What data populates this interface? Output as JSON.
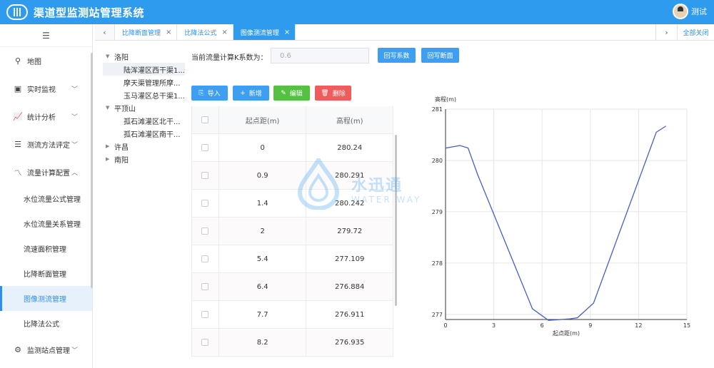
{
  "app": {
    "title": "渠道型监测站管理系统",
    "user_name": "测试"
  },
  "sidebar": {
    "items": [
      {
        "label": "地图",
        "icon": "location-icon",
        "glyph": "⚲",
        "has_chevron": false
      },
      {
        "label": "实时监视",
        "icon": "monitor-icon",
        "glyph": "▣",
        "has_chevron": true
      },
      {
        "label": "统计分析",
        "icon": "stats-icon",
        "glyph": "📈",
        "has_chevron": true
      },
      {
        "label": "测流方法评定",
        "icon": "list-icon",
        "glyph": "☰",
        "has_chevron": true
      },
      {
        "label": "流量计算配置",
        "icon": "flow-icon",
        "glyph": "〽",
        "has_chevron": true
      }
    ],
    "sub_items": [
      "水位流量公式管理",
      "水位流量关系管理",
      "流速面积管理",
      "比降断面管理",
      "图像测流管理",
      "比降法公式"
    ],
    "active_sub": "图像测流管理",
    "last_item": {
      "label": "监测站点管理",
      "icon": "station-icon",
      "glyph": "⚙"
    }
  },
  "tabs": [
    {
      "label": "比降断面管理",
      "active": false
    },
    {
      "label": "比降法公式",
      "active": false
    },
    {
      "label": "图像测流管理",
      "active": true
    }
  ],
  "tab_close_all": "全部关闭",
  "tree": [
    {
      "label": "洛阳",
      "expanded": true,
      "children": [
        "陆浑灌区西干渠1...",
        "摩天渠管理所摩...",
        "玉马灌区总干渠1..."
      ]
    },
    {
      "label": "平顶山",
      "expanded": true,
      "children": [
        "孤石滩灌区北干...",
        "孤石滩灌区南干..."
      ]
    },
    {
      "label": "许昌",
      "expanded": false,
      "children": []
    },
    {
      "label": "南阳",
      "expanded": false,
      "children": []
    }
  ],
  "k_label": "当前流量计算K系数为：",
  "k_value": "0.6",
  "buttons": {
    "write_coef": "回写系数",
    "write_section": "回写断面",
    "import": "导入",
    "add": "新增",
    "edit": "编辑",
    "delete": "删除"
  },
  "table": {
    "headers": [
      "起点距(m)",
      "高程(m)"
    ],
    "rows": [
      [
        "0",
        "280.24"
      ],
      [
        "0.9",
        "280.291"
      ],
      [
        "1.4",
        "280.242"
      ],
      [
        "2",
        "279.72"
      ],
      [
        "5.4",
        "277.109"
      ],
      [
        "6.4",
        "276.884"
      ],
      [
        "7.7",
        "276.911"
      ],
      [
        "8.2",
        "276.935"
      ]
    ]
  },
  "watermark": {
    "text": "水迅通",
    "sub": "WATER WAY"
  },
  "colors": {
    "header": "#2f9bef",
    "accent": "#2f8fe8",
    "green": "#54c142",
    "red": "#f05b5b",
    "line": "#4560c0"
  },
  "chart_data": {
    "type": "line",
    "title": "",
    "xlabel": "起点距(m)",
    "ylabel": "高程(m)",
    "xlim": [
      0,
      15
    ],
    "ylim": [
      276.9,
      281
    ],
    "xticks": [
      0,
      3,
      6,
      9,
      12,
      15
    ],
    "yticks": [
      277,
      278,
      279,
      280,
      281
    ],
    "grid": true,
    "series": [
      {
        "x": [
          0,
          0.9,
          1.4,
          2,
          5.4,
          6.4,
          7.7,
          8.2,
          9.2,
          13.1,
          13.7
        ],
        "y": [
          280.24,
          280.291,
          280.242,
          279.72,
          277.109,
          276.884,
          276.911,
          276.935,
          277.22,
          280.55,
          280.67
        ]
      }
    ]
  }
}
